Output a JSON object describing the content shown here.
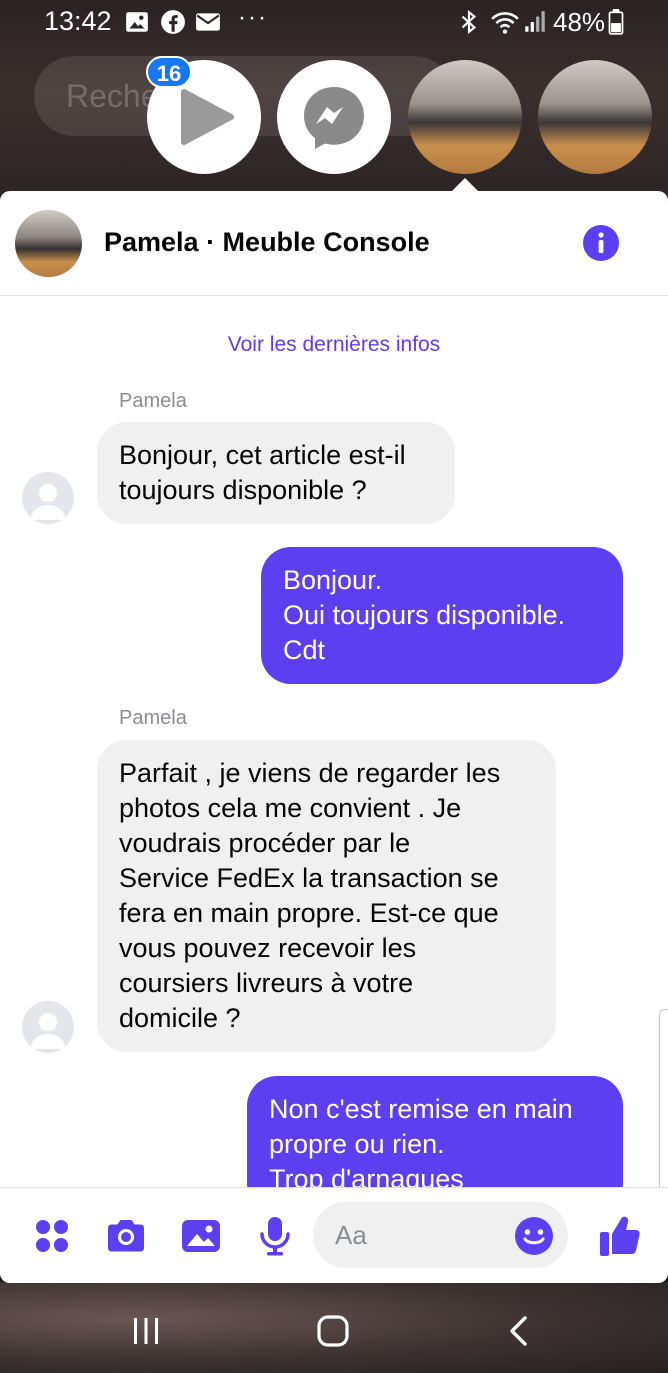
{
  "status_bar": {
    "time": "13:42",
    "battery": "48%",
    "more": "···"
  },
  "background": {
    "search_placeholder": "Reche"
  },
  "chat_heads": {
    "unread_count": "16"
  },
  "header": {
    "title": "Pamela · Meuble Console"
  },
  "conversation": {
    "latest_link": "Voir les dernières infos",
    "messages": [
      {
        "sender": "Pamela",
        "direction": "in",
        "text": "Bonjour, cet article est-il\ntoujours disponible ?"
      },
      {
        "direction": "out",
        "text": "Bonjour.\nOui toujours disponible.\nCdt"
      },
      {
        "sender": "Pamela",
        "direction": "in",
        "text": "Parfait , je viens de regarder les\nphotos cela me convient . Je\nvoudrais procéder par le\nService FedEx la transaction se\nfera en main propre. Est-ce que\nvous pouvez recevoir les\ncoursiers livreurs à votre\ndomicile ?"
      },
      {
        "direction": "out",
        "text": "Non c'est remise en main\npropre ou rien.\nTrop d'arnaques"
      }
    ]
  },
  "composer": {
    "placeholder": "Aa"
  },
  "colors": {
    "accent": "#5b3ff0",
    "incoming_bubble": "#f0f0f0",
    "badge": "#1877f2"
  },
  "icons": [
    "image-icon",
    "facebook-icon",
    "mail-icon",
    "bluetooth-icon",
    "wifi-icon",
    "signal-icon",
    "battery-icon",
    "play-icon",
    "messenger-icon",
    "info-icon",
    "apps-icon",
    "camera-icon",
    "gallery-icon",
    "microphone-icon",
    "emoji-icon",
    "thumbs-up-icon",
    "recent-apps-icon",
    "home-icon",
    "back-icon"
  ]
}
